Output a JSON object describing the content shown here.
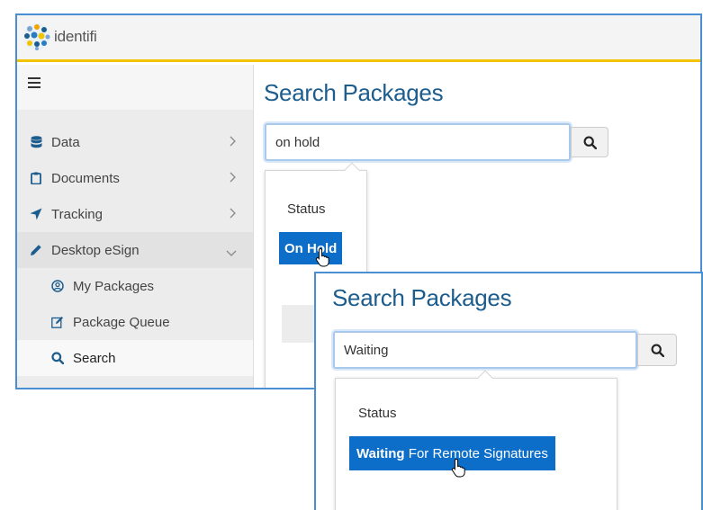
{
  "app": {
    "logo_text": "identifi"
  },
  "sidebar": {
    "items": [
      {
        "label": "Data",
        "icon": "database-icon"
      },
      {
        "label": "Documents",
        "icon": "clipboard-icon"
      },
      {
        "label": "Tracking",
        "icon": "location-arrow-icon"
      },
      {
        "label": "Desktop eSign",
        "icon": "pencil-icon",
        "expanded": true
      }
    ],
    "subitems": [
      {
        "label": "My Packages",
        "icon": "user-circle-icon"
      },
      {
        "label": "Package Queue",
        "icon": "edit-icon"
      },
      {
        "label": "Search",
        "icon": "search-icon",
        "active": true
      }
    ]
  },
  "main": {
    "title": "Search Packages",
    "search_value": "on hold",
    "dropdown": {
      "group_label": "Status",
      "option_match": "On Hold",
      "option_rest": ""
    }
  },
  "overlay": {
    "title": "Search Packages",
    "search_value": "Waiting",
    "dropdown": {
      "group_label": "Status",
      "option_match": "Waiting",
      "option_rest": " For Remote Signatures"
    }
  },
  "colors": {
    "accent_blue": "#0c6ec9",
    "title_blue": "#1c5d8e",
    "topbar_underline": "#f2c300",
    "frame_border": "#4a8fd1"
  }
}
